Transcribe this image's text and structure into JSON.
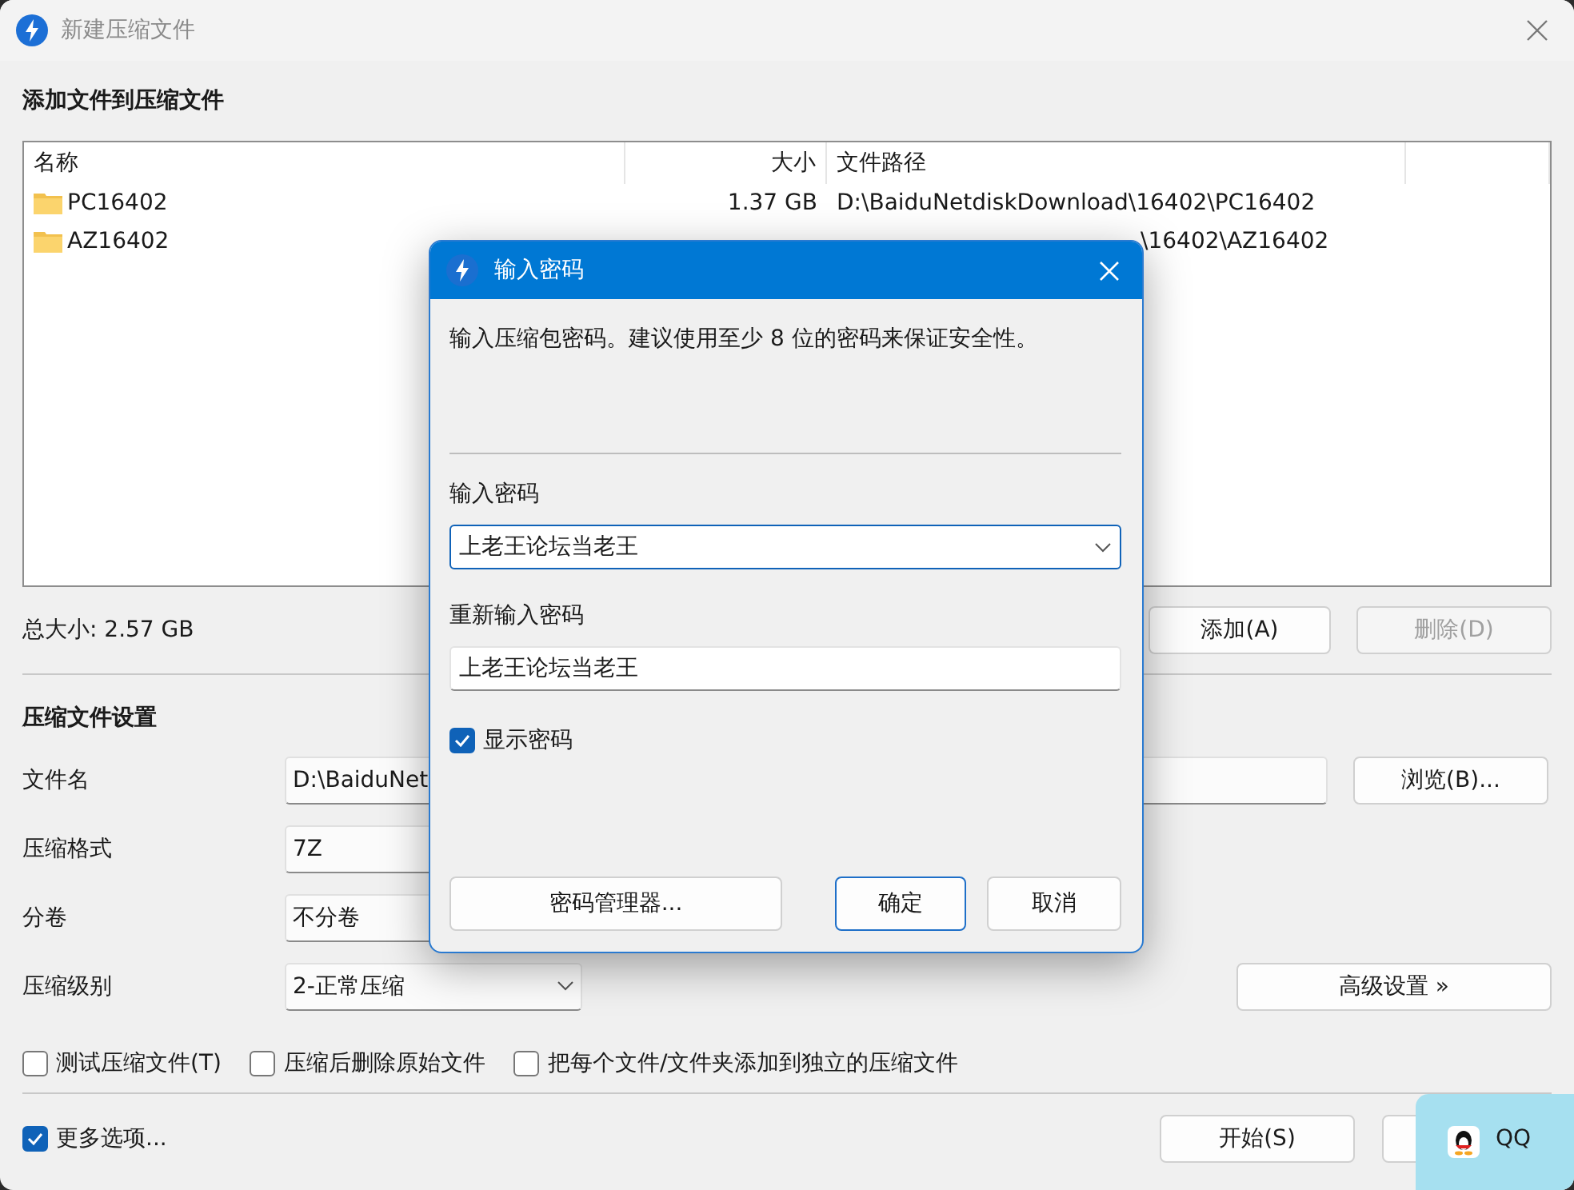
{
  "window": {
    "title": "新建压缩文件"
  },
  "add_section": {
    "heading": "添加文件到压缩文件"
  },
  "file_list": {
    "columns": [
      "名称",
      "大小",
      "文件路径"
    ],
    "rows": [
      {
        "name": "PC16402",
        "size": "1.37 GB",
        "path": "D:\\BaiduNetdiskDownload\\16402\\PC16402",
        "partly_covered": false
      },
      {
        "name": "AZ16402",
        "path": "\\16402\\AZ16402",
        "partly_covered": true
      }
    ]
  },
  "total_size": "总大小: 2.57 GB",
  "list_buttons": [
    {
      "label": "添加(A)",
      "disabled": false
    },
    {
      "label": "删除(D)",
      "disabled": true
    }
  ],
  "settings": {
    "heading": "压缩文件设置",
    "rows": [
      {
        "kind": "text",
        "label": "文件名",
        "value": "D:\\BaiduNet",
        "button": "浏览(B)..."
      },
      {
        "kind": "select",
        "label": "压缩格式",
        "value": "7Z"
      },
      {
        "kind": "select",
        "label": "分卷",
        "value": "不分卷"
      },
      {
        "kind": "dropdown",
        "label": "压缩级别",
        "value": "2-正常压缩",
        "button": "高级设置 »"
      }
    ]
  },
  "options": [
    {
      "label": "测试压缩文件(T)",
      "checked": false
    },
    {
      "label": "压缩后删除原始文件",
      "checked": false
    },
    {
      "label": "把每个文件/文件夹添加到独立的压缩文件",
      "checked": false
    }
  ],
  "more_options": {
    "label": "更多选项...",
    "checked": true
  },
  "footer_buttons": [
    {
      "kind": "labeled",
      "label": "开始(S)"
    },
    {
      "kind": "covered"
    }
  ],
  "dialog": {
    "title": "输入密码",
    "hint": "输入压缩包密码。建议使用至少 8 位的密码来保证安全性。",
    "password_label": "输入密码",
    "password": "上老王论坛当老王",
    "repeat_label": "重新输入密码",
    "repeat": "上老王论坛当老王",
    "show_password": {
      "label": "显示密码",
      "checked": true
    },
    "buttons": [
      {
        "kind": "wide",
        "label": "密码管理器..."
      },
      {
        "kind": "default",
        "label": "确定"
      },
      {
        "kind": "normal",
        "label": "取消"
      }
    ]
  },
  "notification": {
    "label": "QQ"
  }
}
